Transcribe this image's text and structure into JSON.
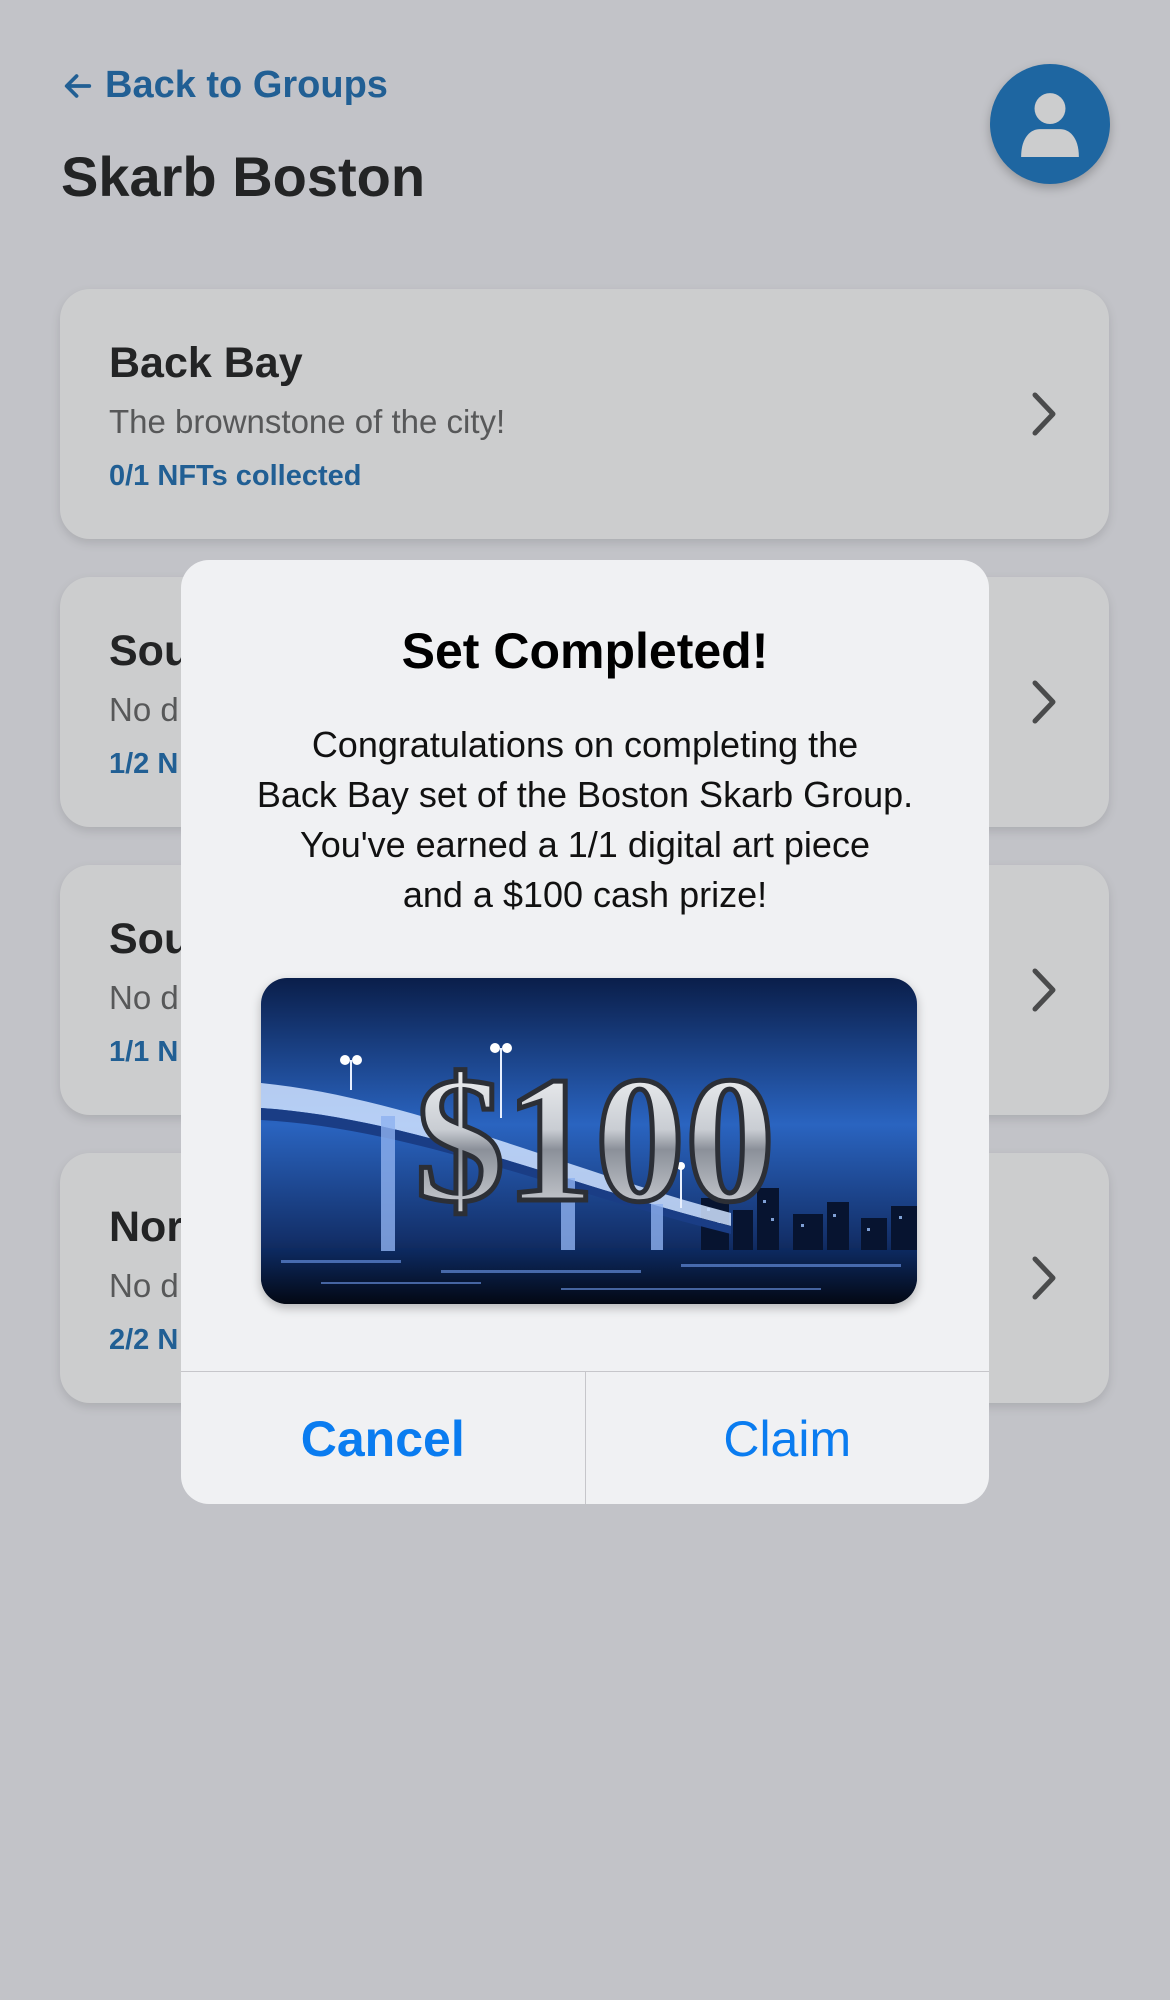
{
  "header": {
    "back_label": "Back to Groups",
    "title": "Skarb Boston",
    "avatar_icon": "user-icon"
  },
  "groups": [
    {
      "title": "Back Bay",
      "description": "The brownstone of the city!",
      "progress": "0/1 NFTs collected"
    },
    {
      "title": "Sou",
      "description": "No d",
      "progress": "1/2 N"
    },
    {
      "title": "Sou",
      "description": "No d",
      "progress": "1/1 N"
    },
    {
      "title": "Nor",
      "description": "No d",
      "progress": "2/2 N"
    }
  ],
  "alert": {
    "title": "Set Completed!",
    "message_lines": [
      "Congratulations on completing the",
      "Back Bay set of the Boston Skarb Group.",
      "You've earned a 1/1 digital art piece",
      "and a $100 cash prize!"
    ],
    "prize_text": "$100",
    "cancel_label": "Cancel",
    "claim_label": "Claim"
  },
  "colors": {
    "accent": "#1f6fb3",
    "alert_button": "#0a7cf0",
    "background": "#f2f2f7"
  }
}
